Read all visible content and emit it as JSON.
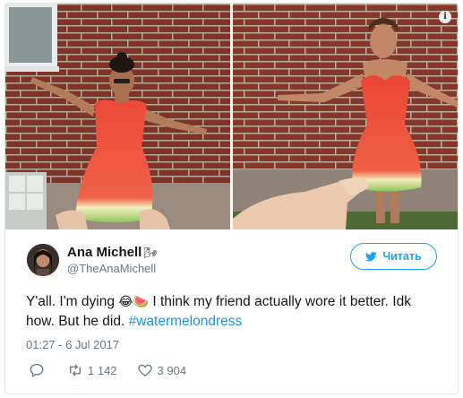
{
  "tweet": {
    "author": {
      "display_name": "Ana Michell",
      "name_emoji": "🌬",
      "handle": "@TheAnaMichell"
    },
    "follow_button_label": "Читать",
    "text_before_emoji": "Y'all. I'm dying ",
    "emojis": "😂🍉",
    "text_after_emoji": " I think my friend actually wore it better. Idk how. But he did. ",
    "hashtag": "#watermelondress",
    "timestamp": "01:27 - 6 Jul 2017",
    "retweets": "1 142",
    "likes": "3 904",
    "info_glyph": "i"
  },
  "icons": {
    "reply": "reply-icon",
    "retweet": "retweet-icon",
    "like": "heart-icon",
    "follow": "twitter-bird-icon",
    "info": "info-icon"
  },
  "colors": {
    "accent": "#1da1f2",
    "hashtag": "#1b95e0",
    "secondary_text": "#657786",
    "border": "#e1e8ed",
    "brick": "#8b3a2c",
    "watermelon": "#e8493a",
    "rind": "#9ccf6a"
  }
}
